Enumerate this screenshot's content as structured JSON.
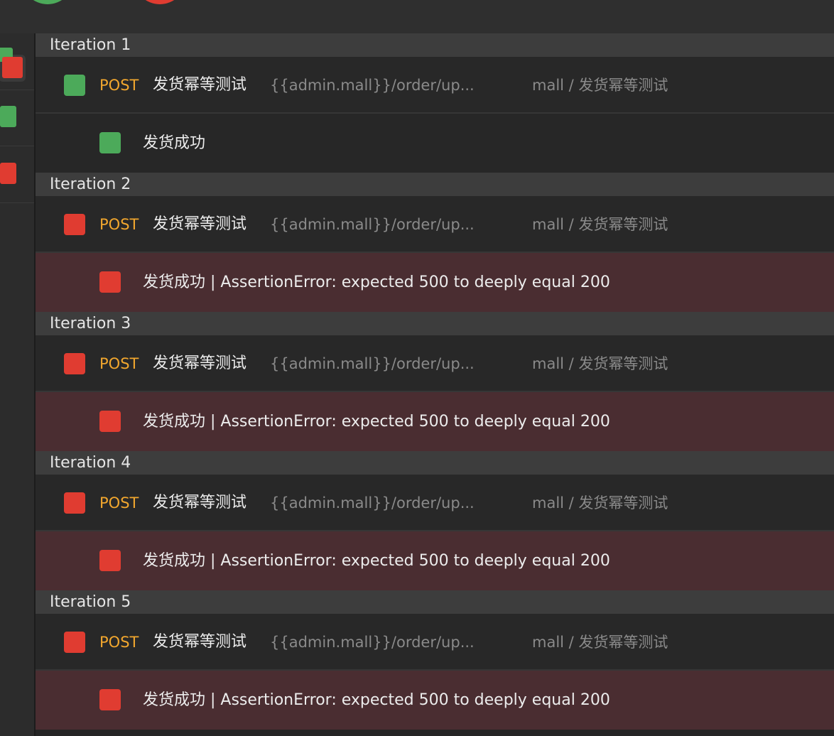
{
  "colors": {
    "pass": "#4caa5a",
    "fail": "#e03c31",
    "method": "#f2a72e"
  },
  "left_rows": [
    {
      "status": "fail",
      "selected": true
    },
    {
      "status": "pass",
      "selected": false
    },
    {
      "status": "fail",
      "selected": false
    }
  ],
  "iterations": [
    {
      "label": "Iteration 1",
      "request": {
        "status": "pass",
        "method": "POST",
        "name": "发货幂等测试",
        "url": "{{admin.mall}}/order/up...",
        "path": "mall / 发货幂等测试"
      },
      "assertion": {
        "status": "pass",
        "text": "发货成功"
      }
    },
    {
      "label": "Iteration 2",
      "request": {
        "status": "fail",
        "method": "POST",
        "name": "发货幂等测试",
        "url": "{{admin.mall}}/order/up...",
        "path": "mall / 发货幂等测试"
      },
      "assertion": {
        "status": "fail",
        "text": "发货成功 | AssertionError: expected 500 to deeply equal 200"
      }
    },
    {
      "label": "Iteration 3",
      "request": {
        "status": "fail",
        "method": "POST",
        "name": "发货幂等测试",
        "url": "{{admin.mall}}/order/up...",
        "path": "mall / 发货幂等测试"
      },
      "assertion": {
        "status": "fail",
        "text": "发货成功 | AssertionError: expected 500 to deeply equal 200"
      }
    },
    {
      "label": "Iteration 4",
      "request": {
        "status": "fail",
        "method": "POST",
        "name": "发货幂等测试",
        "url": "{{admin.mall}}/order/up...",
        "path": "mall / 发货幂等测试"
      },
      "assertion": {
        "status": "fail",
        "text": "发货成功 | AssertionError: expected 500 to deeply equal 200"
      }
    },
    {
      "label": "Iteration 5",
      "request": {
        "status": "fail",
        "method": "POST",
        "name": "发货幂等测试",
        "url": "{{admin.mall}}/order/up...",
        "path": "mall / 发货幂等测试"
      },
      "assertion": {
        "status": "fail",
        "text": "发货成功 | AssertionError: expected 500 to deeply equal 200"
      }
    }
  ]
}
